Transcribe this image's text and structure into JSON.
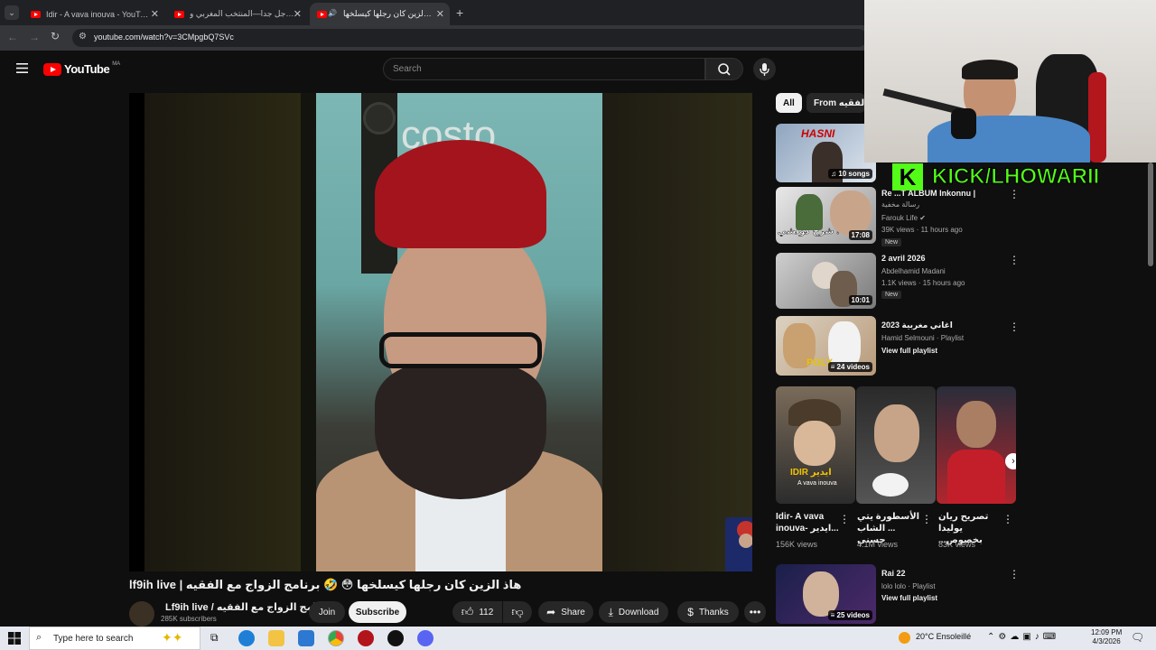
{
  "browser": {
    "tabs": [
      {
        "label": "Idir - A vava inouva - YouTube"
      },
      {
        "label": "عااجل جدا—المنتخب المغربي و"
      },
      {
        "label": "هاذ الزين كان رجلها كيسلخها"
      }
    ],
    "url": "youtube.com/watch?v=3CMpgbQ7SVc"
  },
  "yt": {
    "logo": "YouTube",
    "region": "MA",
    "search_placeholder": "Search"
  },
  "video": {
    "watermark": "costo",
    "title": "lf9ih live | هاذ الزين كان رجلها كيسلخها 😳 🤣 برنامج الزواج مع الفقيه",
    "channel": "Lf9ih live / برنامج الزواج مع الفقيه",
    "subscribers": "285K subscribers",
    "join_label": "Join",
    "subscribe_label": "Subscribe",
    "likes": "112",
    "share_label": "Share",
    "download_label": "Download",
    "thanks_label": "Thanks"
  },
  "sidebar": {
    "chips": [
      "All",
      "From برنامج الزواج مع الفقيه"
    ],
    "items": [
      {
        "badge": "10 songs",
        "thumb_text": "HASNI"
      },
      {
        "title": "Re ...T ALBUM Inkonnu |",
        "subtitle": "رسالة مخفية",
        "channel": "Farouk Life",
        "meta": "39K views · 11 hours ago",
        "tag": "New",
        "duration": "17:08",
        "thumb_text": "شرح كولشي !"
      },
      {
        "title": "2 avril 2026",
        "channel": "Abdelhamid Madani",
        "meta": "1.1K views · 15 hours ago",
        "tag": "New",
        "duration": "10:01"
      },
      {
        "title": "اغاني مغربية 2023",
        "channel": "Hamid Selmouni · Playlist",
        "meta": "View full playlist",
        "badge": "24 videos"
      },
      {
        "title": "Rai 22",
        "channel": "lolo lolo · Playlist",
        "meta": "View full playlist",
        "badge": "25 videos"
      }
    ],
    "shorts": [
      {
        "title": "Idir- A vava inouva- ايدير...",
        "views": "156K views",
        "thumb_text": "IDIR ايدير",
        "thumb_sub": "A vava inouva"
      },
      {
        "title": "الأسطورة يتي ... الشاب حسني",
        "views": "4.1M views"
      },
      {
        "title": "تصريح ريان يوليدا بخصوص...",
        "views": "83K views"
      }
    ]
  },
  "overlay": {
    "kick_text": "KICK/LHOWARII",
    "kick_letter": "K"
  },
  "taskbar": {
    "search_placeholder": "Type here to search",
    "weather": "20°C  Ensoleillé",
    "time": "12:09 PM",
    "date": "4/3/2026"
  },
  "colors": {
    "bg": "#0f0f0f",
    "yt_red": "#ff0000",
    "kick_green": "#53fc18"
  }
}
